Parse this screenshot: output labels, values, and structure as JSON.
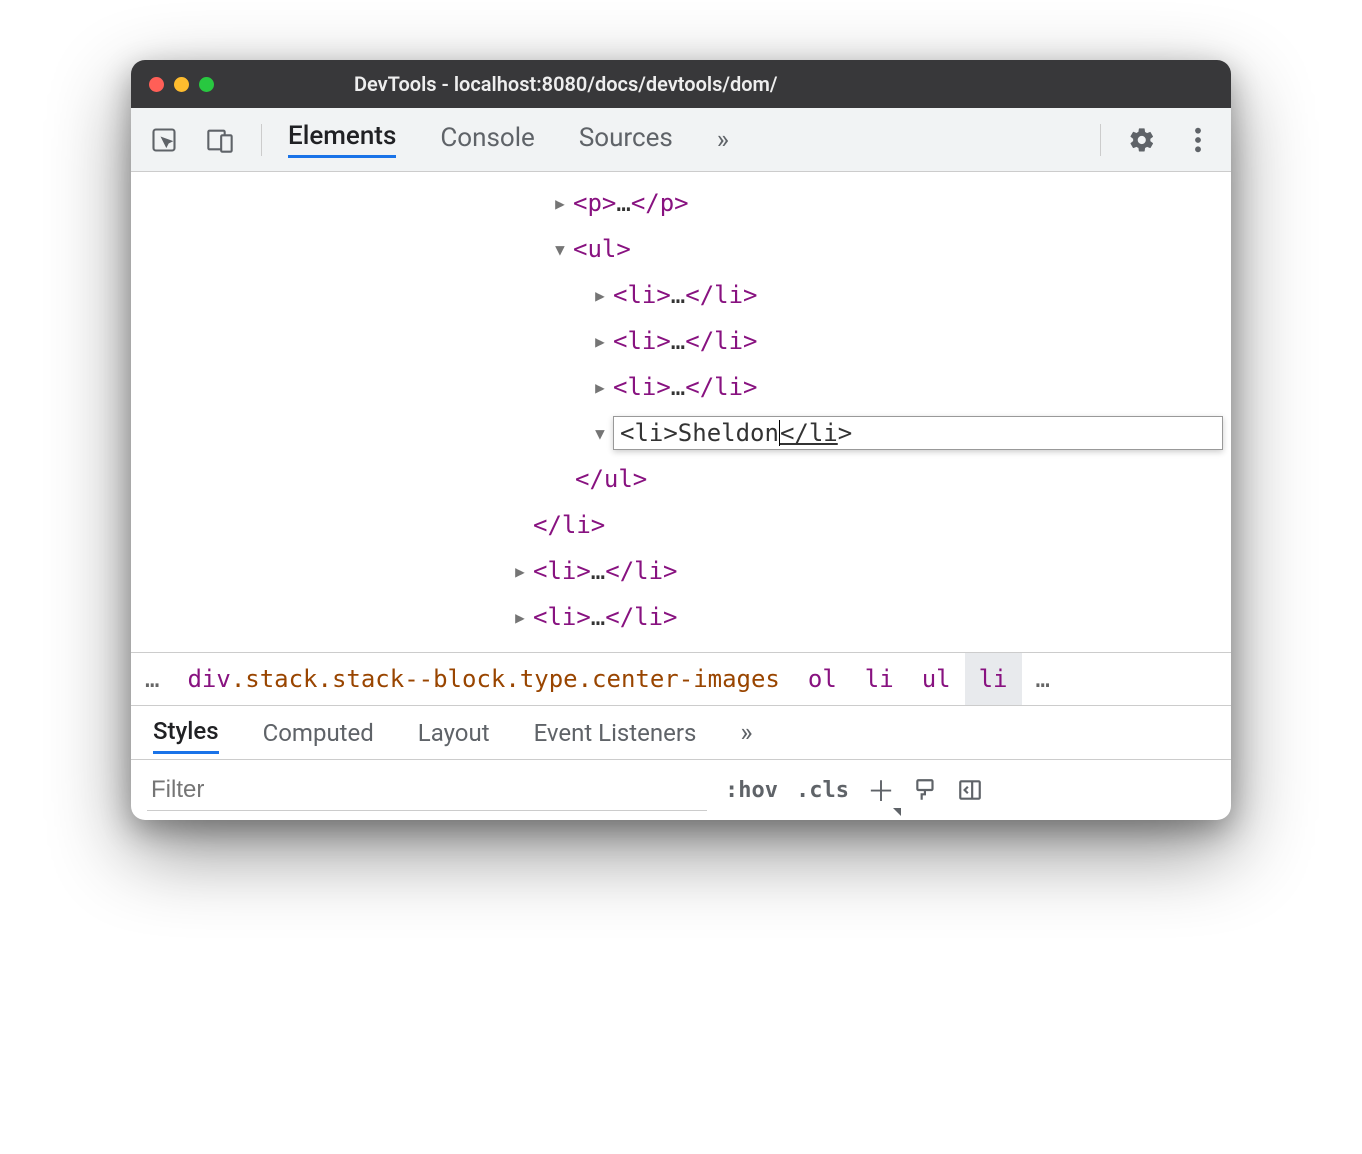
{
  "window": {
    "title": "DevTools - localhost:8080/docs/devtools/dom/"
  },
  "toolbar": {
    "tabs": {
      "elements": "Elements",
      "console": "Console",
      "sources": "Sources"
    }
  },
  "dom": {
    "p_open": "<p>",
    "p_close": "</p>",
    "ul_open": "<ul>",
    "ul_close": "</ul>",
    "li_open": "<li>",
    "li_close": "</li>",
    "ellipsis": "…",
    "edit_raw_open": "<li>",
    "edit_text": "Sheldon",
    "edit_close_hi": "</li",
    "edit_close_rest": ">",
    "outer_li_close": "</li>"
  },
  "breadcrumbs": {
    "start_ellipsis": "…",
    "div": "div",
    "div_classes": ".stack.stack--block.type.center-images",
    "ol": "ol",
    "li1": "li",
    "ul": "ul",
    "li2": "li",
    "end_ellipsis": "…"
  },
  "styles": {
    "tabs": {
      "styles": "Styles",
      "computed": "Computed",
      "layout": "Layout",
      "event_listeners": "Event Listeners"
    },
    "filter_placeholder": "Filter",
    "hov": ":hov",
    "cls": ".cls"
  }
}
